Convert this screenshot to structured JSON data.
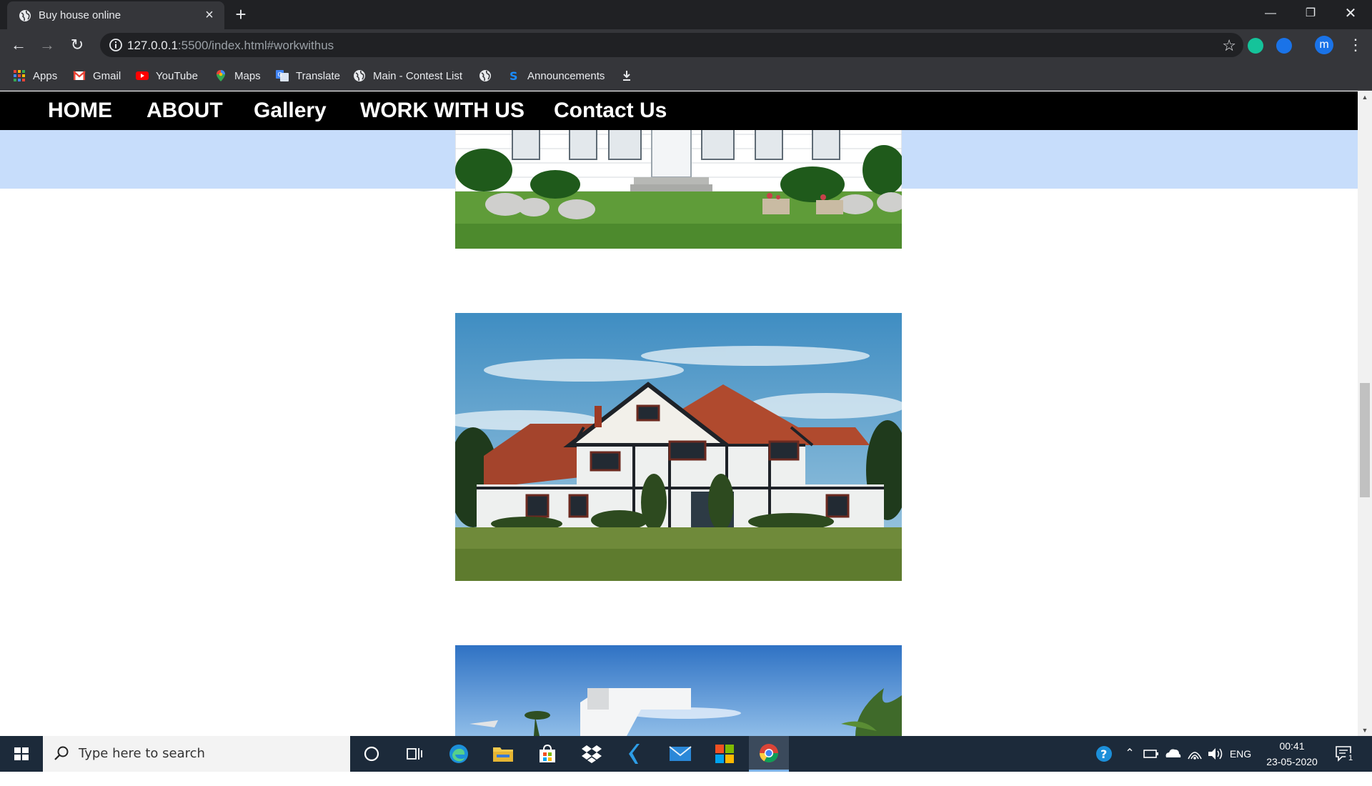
{
  "browser": {
    "tab_title": "Buy house online",
    "url_host": "127.0.0.1",
    "url_rest": ":5500/index.html#workwithus",
    "profile_initial": "m",
    "bookmarks": [
      "Apps",
      "Gmail",
      "YouTube",
      "Maps",
      "Translate",
      "Main - Contest List",
      "Announcements"
    ]
  },
  "site_nav": {
    "items": [
      "HOME",
      "ABOUT",
      "Gallery",
      "WORK WITH US",
      "Contact Us"
    ]
  },
  "colors": {
    "nav_bg": "#000000",
    "band": "#c7ddfb",
    "taskbar": "#1c2a3a"
  },
  "taskbar": {
    "search_placeholder": "Type here to search",
    "lang": "ENG",
    "time": "00:41",
    "date": "23-05-2020",
    "notification_count": "1"
  }
}
